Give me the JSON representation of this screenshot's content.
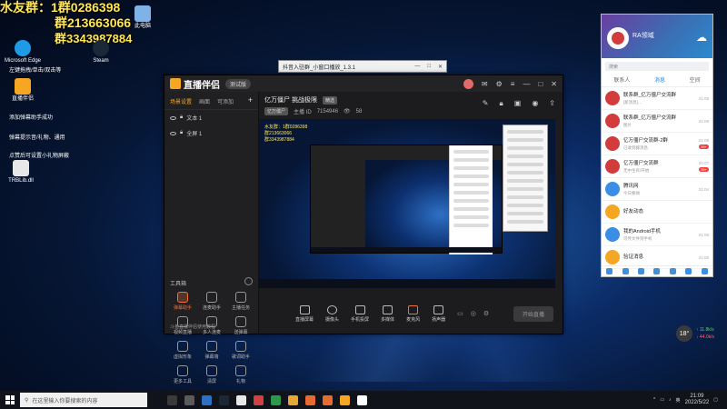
{
  "desktop": {
    "overlay_line1": "水友群：1群0286398",
    "overlay_line2": "群213663066",
    "overlay_line3": "群3343987884",
    "icons": [
      {
        "label": "此电脑",
        "color": "#7fb2e6"
      },
      {
        "label": "Microsoft Edge",
        "color": "#1f9be6"
      },
      {
        "label": "Steam",
        "color": "#1b2838"
      },
      {
        "label": "直播伴侣",
        "color": "#f5a623"
      },
      {
        "label": "TRBLib.dll",
        "color": "#e8e8e8"
      }
    ],
    "lines": [
      "左键拖拽/单击/双击等",
      "添加弹幕助手成功",
      "弹幕提示音/礼物、通用",
      "点赞后可设置小礼物屏蔽"
    ]
  },
  "small_window": {
    "title": "抖音入驻群_小窗口播放_1.3.1",
    "controls": [
      "—",
      "□",
      "✕"
    ]
  },
  "app": {
    "name": "直播伴侣",
    "version": "测试版",
    "left_tabs": [
      "场景设置",
      "画面",
      "可添加"
    ],
    "scenes": [
      {
        "label": "文本 1"
      },
      {
        "label": "全屏 1"
      }
    ],
    "toolbox_title": "工具箱",
    "tools": [
      {
        "label": "弹幕助手",
        "hot": true
      },
      {
        "label": "连麦助手",
        "hot": false
      },
      {
        "label": "主播任务",
        "hot": false
      },
      {
        "label": "视频直播",
        "hot": false
      },
      {
        "label": "多人连麦",
        "hot": false
      },
      {
        "label": "送弹幕",
        "hot": false
      },
      {
        "label": "虚拟形象",
        "hot": false
      },
      {
        "label": "弹幕墙",
        "hot": false
      },
      {
        "label": "歌词助手",
        "hot": false
      },
      {
        "label": "更多工具",
        "hot": false
      },
      {
        "label": "清屏",
        "hot": false
      },
      {
        "label": "礼物",
        "hot": false
      }
    ],
    "footer_note": "斗鱼直播伴侣使用教程",
    "stream_title": "亿万僵尸 挑战极限",
    "stream_tag": "精选",
    "stream_sub_tag": "亿万僵尸",
    "stream_owner": "主播 ID",
    "stream_id": "7154946",
    "stream_viewers": "58",
    "controls": [
      {
        "label": "直播屏幕"
      },
      {
        "label": "摄像头"
      },
      {
        "label": "手机投屏"
      },
      {
        "label": "多媒体"
      },
      {
        "label": "麦克风"
      },
      {
        "label": "扬声器"
      }
    ],
    "go_live_label": "开始直播"
  },
  "qq": {
    "nickname": "RA领域",
    "search_placeholder": "搜索",
    "tabs": [
      "联系人",
      "消息",
      "空间"
    ],
    "active_tab": 1,
    "rows": [
      {
        "name": "联系群_亿万僵尸交流群",
        "msg": "[新消息]…",
        "time": "21:09",
        "badge": "",
        "color": "#d23c3c"
      },
      {
        "name": "联系群_亿万僵尸交流群",
        "msg": "图片",
        "time": "21:09",
        "badge": "",
        "color": "#d23c3c"
      },
      {
        "name": "亿万僵尸交流群-2群",
        "msg": "已收到群消息",
        "time": "21:09",
        "badge": "99+",
        "color": "#d23c3c"
      },
      {
        "name": "亿万僵尸交流群",
        "msg": "无中生有/开始",
        "time": "20:07",
        "badge": "99+",
        "color": "#d23c3c"
      },
      {
        "name": "腾讯网",
        "msg": "今日要闻",
        "time": "21:04",
        "badge": "",
        "color": "#3a8ee6"
      },
      {
        "name": "好友动态",
        "msg": "",
        "time": "",
        "badge": "",
        "color": "#f5a623"
      },
      {
        "name": "我的Android手机",
        "msg": "可传文件到手机",
        "time": "21:05",
        "badge": "",
        "color": "#3a8ee6"
      },
      {
        "name": "验证消息",
        "msg": "",
        "time": "21:05",
        "badge": "",
        "color": "#f5a623"
      }
    ]
  },
  "weather": {
    "temp": "18°",
    "up": "11.8k/s",
    "down": "44.0k/s"
  },
  "taskbar": {
    "search_placeholder": "在这里输入你要搜索的内容",
    "apps": [
      "#3a3a3a",
      "#5a5a5a",
      "#2d6fc4",
      "#1b2838",
      "#e8e8e8",
      "#d24141",
      "#2a9a4a",
      "#e8a634",
      "#e66a32",
      "#e66a32",
      "#f5a623",
      "#ffffff"
    ],
    "time": "21:09",
    "date": "2022/5/22",
    "lang": "英"
  }
}
